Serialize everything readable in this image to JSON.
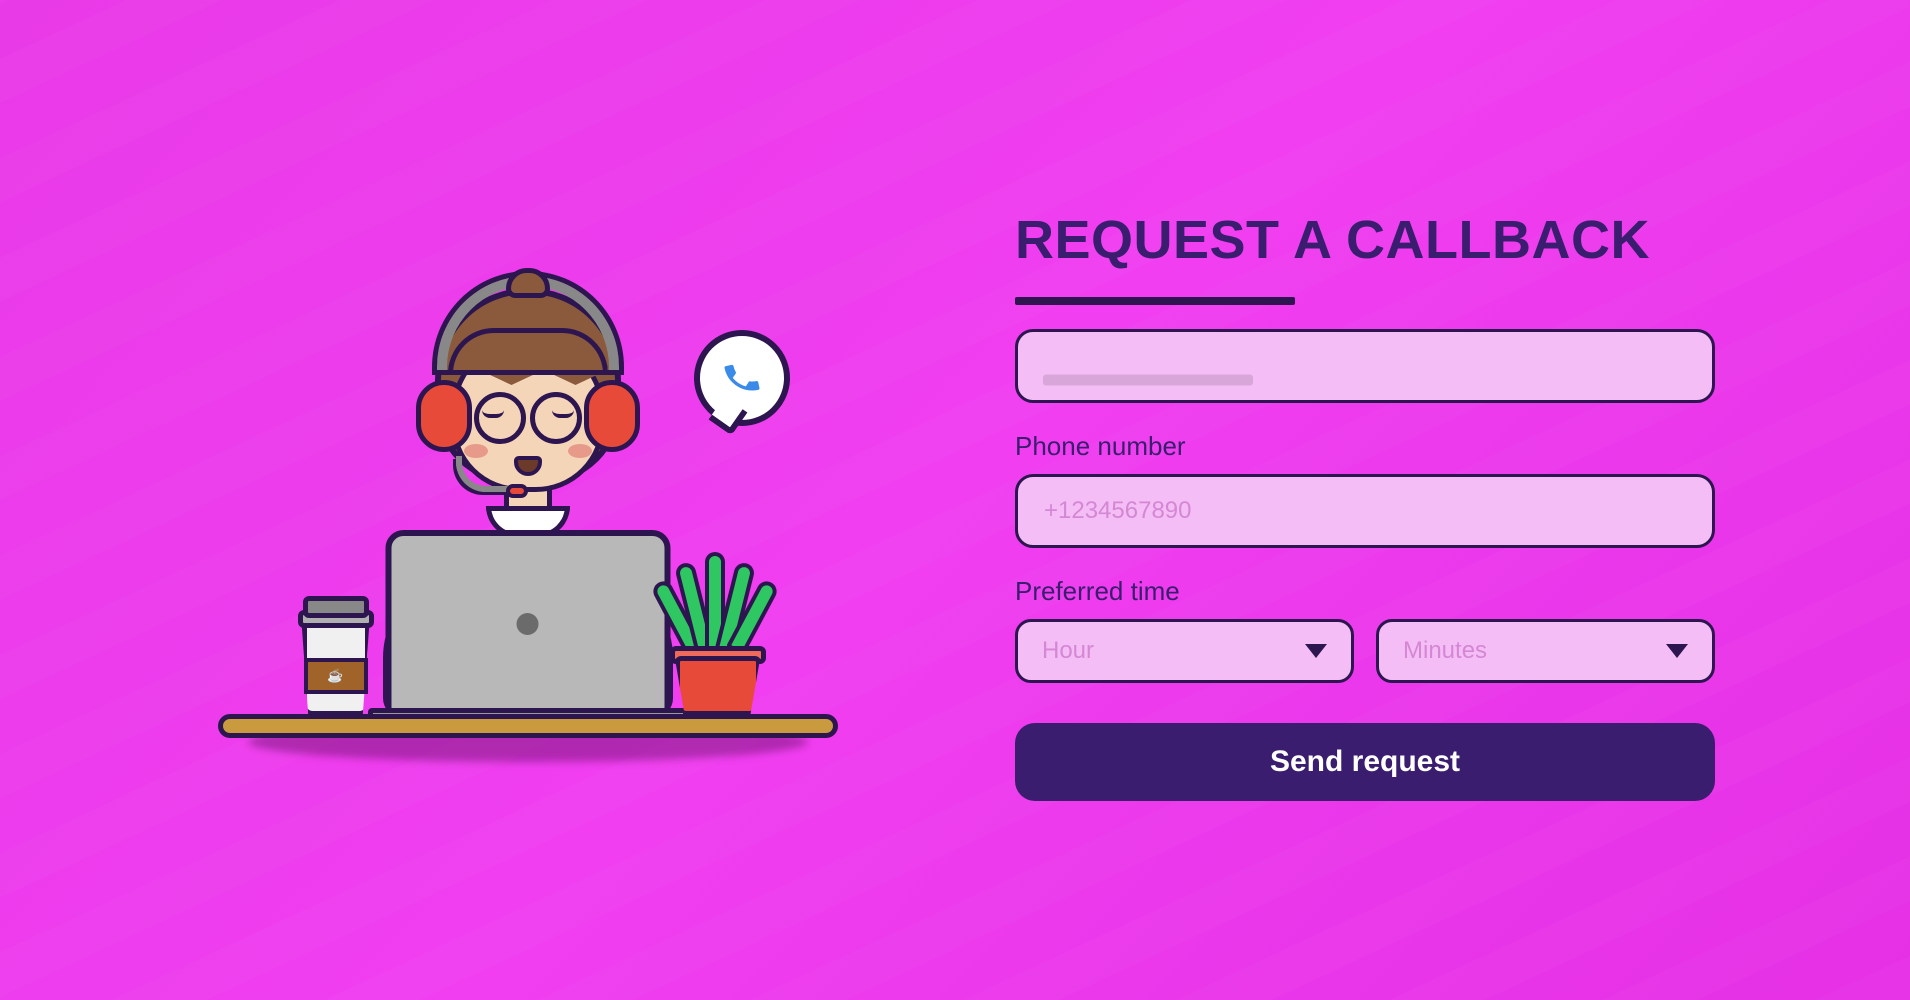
{
  "form": {
    "title": "REQUEST A CALLBACK",
    "name_field": {
      "value": "",
      "placeholder": " "
    },
    "phone_field": {
      "label": "Phone number",
      "value": "",
      "placeholder": "+1234567890"
    },
    "time_field": {
      "label": "Preferred time",
      "hour_placeholder": "Hour",
      "minutes_placeholder": "Minutes"
    },
    "submit_label": "Send request"
  },
  "illustration": {
    "bubble_icon": "phone-icon",
    "cup_badge": "☕"
  },
  "colors": {
    "bg_gradient_from": "#e93ae8",
    "bg_gradient_to": "#e530e5",
    "primary_dark": "#3a1d6e",
    "outline": "#2d1650",
    "input_bg": "#f5bdf5",
    "input_placeholder": "#d488d4"
  }
}
